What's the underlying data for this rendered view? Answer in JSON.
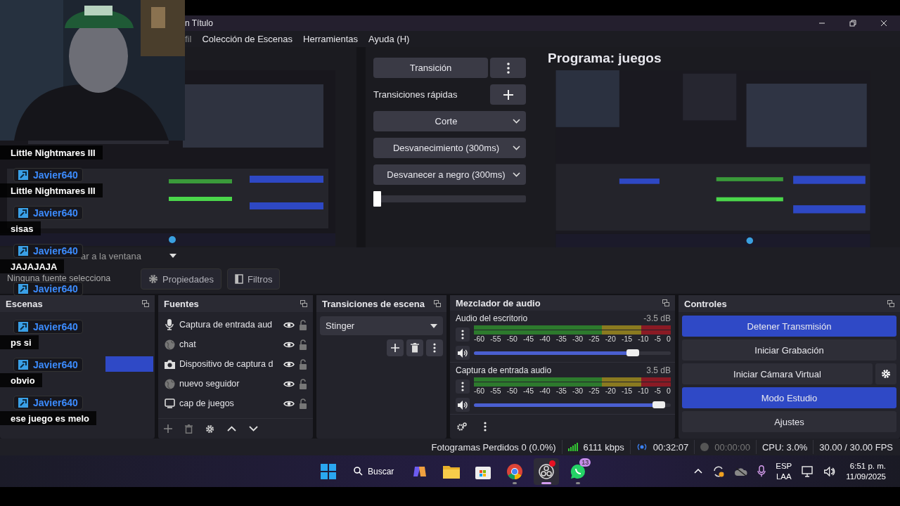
{
  "window": {
    "title": "n Título"
  },
  "menu": [
    "fil",
    "Colección de Escenas",
    "Herramientas",
    "Ayuda (H)"
  ],
  "preview": {
    "kind": "picture"
  },
  "transition_panel": {
    "transition_button": "Transición",
    "quick_label": "Transiciones rápidas",
    "quick_transitions": [
      "Corte",
      "Desvanecimiento (300ms)",
      "Desvanecer a negro (300ms)"
    ],
    "tbar": {
      "level": 0
    }
  },
  "program": {
    "title": "Programa: juegos",
    "kind": "picture"
  },
  "source_toolbar": {
    "partial_label": "ar a la ventana",
    "status": "Ninguna fuente selecciona",
    "buttons": [
      "Propiedades",
      "Filtros"
    ]
  },
  "scenes": {
    "title": "Escenas"
  },
  "sources": {
    "title": "Fuentes",
    "items": [
      {
        "kind": "mic",
        "name": "Captura de entrada aud",
        "visible": true,
        "locked": false
      },
      {
        "kind": "globe",
        "name": "chat",
        "visible": true,
        "locked": false
      },
      {
        "kind": "camera",
        "name": "Dispositivo de captura d",
        "visible": true,
        "locked": false
      },
      {
        "kind": "globe",
        "name": "nuevo seguidor",
        "visible": true,
        "locked": false
      },
      {
        "kind": "monitor",
        "name": "cap de juegos",
        "visible": true,
        "locked": false
      }
    ]
  },
  "scene_transitions": {
    "title": "Transiciones de escena",
    "selected": "Stinger"
  },
  "mixer": {
    "title": "Mezclador de audio",
    "channels": [
      {
        "name": "Audio del escritorio",
        "reading": "-3.5 dB",
        "scale": [
          "-60",
          "-55",
          "-50",
          "-45",
          "-40",
          "-35",
          "-30",
          "-25",
          "-20",
          "-15",
          "-10",
          "-5",
          "0"
        ],
        "level": 0.84
      },
      {
        "name": "Captura de entrada audio",
        "reading": "3.5 dB",
        "scale": [
          "-60",
          "-55",
          "-50",
          "-45",
          "-40",
          "-35",
          "-30",
          "-25",
          "-20",
          "-15",
          "-10",
          "-5",
          "0"
        ],
        "level": 0.97
      }
    ]
  },
  "controls": {
    "title": "Controles",
    "buttons": [
      {
        "label": "Detener Transmisión",
        "active": true,
        "settings": false
      },
      {
        "label": "Iniciar Grabación",
        "active": false,
        "settings": false
      },
      {
        "label": "Iniciar Cámara Virtual",
        "active": false,
        "settings": true
      },
      {
        "label": "Modo Estudio",
        "active": true,
        "settings": false
      },
      {
        "label": "Ajustes",
        "active": false,
        "settings": false
      }
    ]
  },
  "status_bar": {
    "dropped": "Fotogramas Perdidos 0 (0.0%)",
    "bitrate": "6111 kbps",
    "stream_time": "00:32:07",
    "record_time": "00:00:00",
    "cpu": "CPU: 3.0%",
    "fps": "30.00 / 30.00 FPS"
  },
  "taskbar": {
    "search": "Buscar",
    "apps": [
      {
        "kind": "copilot",
        "running": false,
        "active": false,
        "alert": false
      },
      {
        "kind": "folder",
        "running": false,
        "active": false,
        "alert": false
      },
      {
        "kind": "store",
        "running": false,
        "active": false,
        "alert": false
      },
      {
        "kind": "chrome",
        "running": true,
        "active": false,
        "alert": false
      },
      {
        "kind": "obs",
        "running": true,
        "active": true,
        "alert": true
      },
      {
        "kind": "whatsapp",
        "running": true,
        "active": false,
        "alert": false,
        "badge": "13"
      }
    ],
    "language": [
      "ESP",
      "LAA"
    ],
    "time": "6:51 p. m.",
    "date": "11/09/2025"
  },
  "webcam": {
    "kind": "picture"
  },
  "chat": [
    {
      "text": "Little Nightmares III"
    },
    {
      "user": "Javier640",
      "text": "Little Nightmares III"
    },
    {
      "user": "Javier640",
      "text": "sisas"
    },
    {
      "user": "Javier640",
      "text": "JAJAJAJA"
    },
    {
      "user": "Javier640"
    },
    {
      "user": "Javier640",
      "text": "ps si"
    },
    {
      "user": "Javier640",
      "text": "obvio"
    },
    {
      "user": "Javier640",
      "text": "ese juego es melo"
    }
  ]
}
